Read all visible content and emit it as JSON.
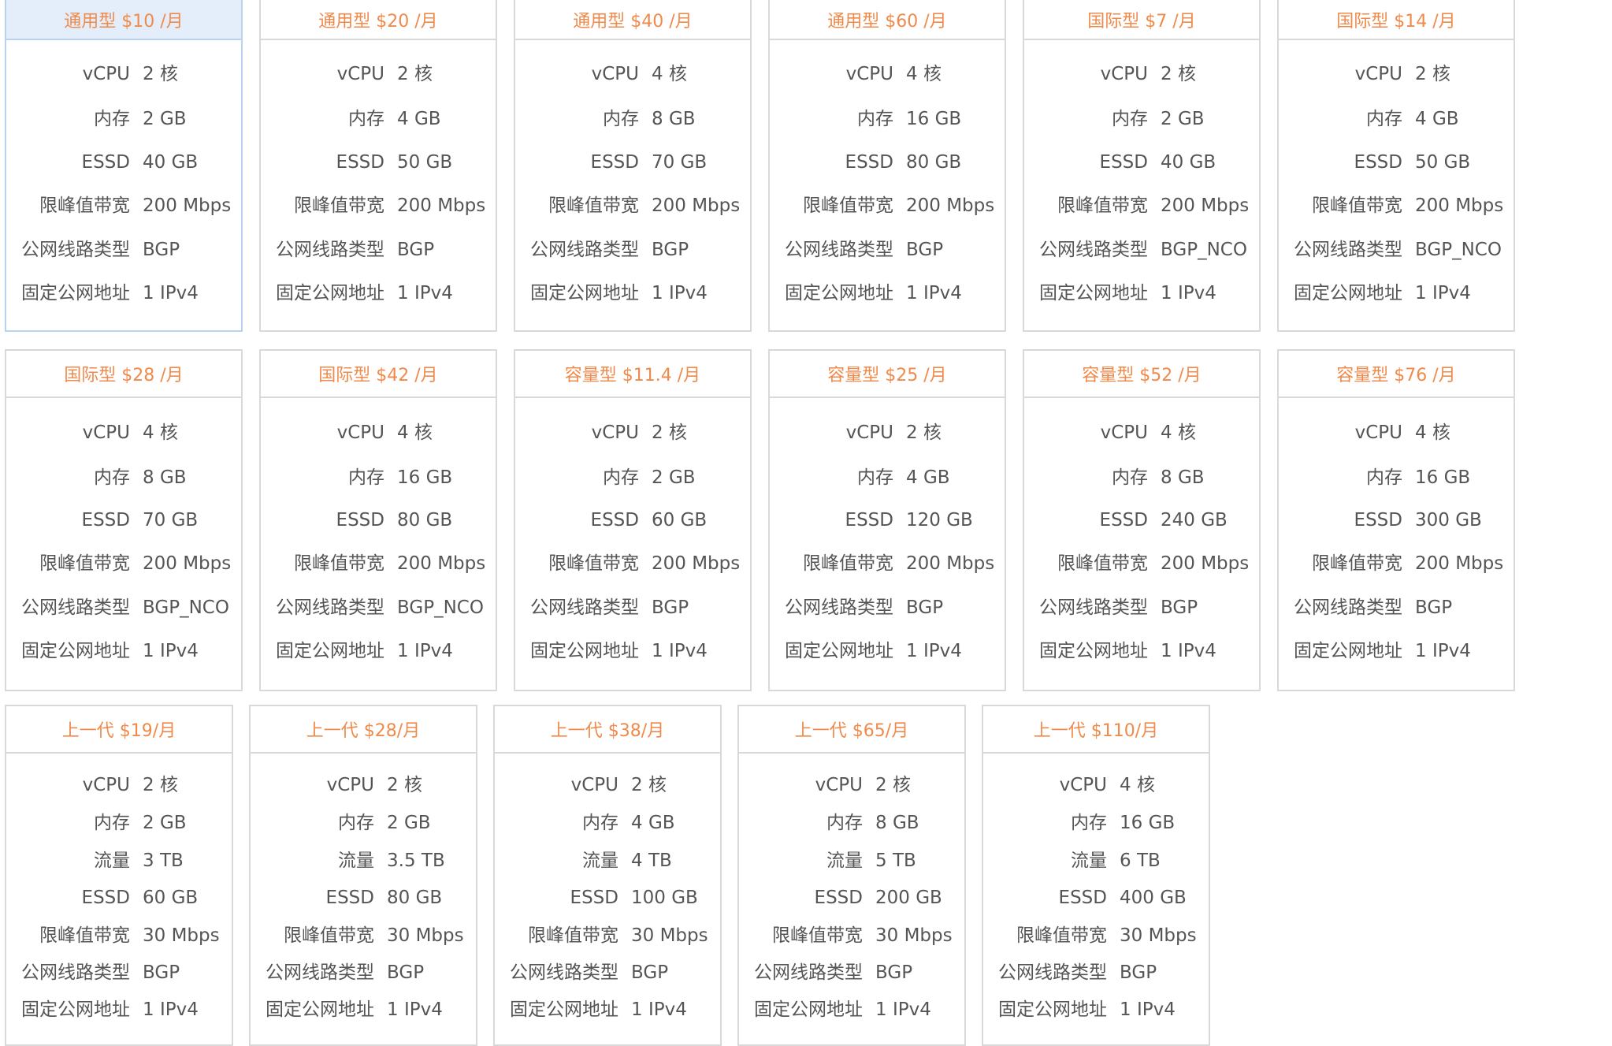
{
  "plans": [
    {
      "title": "通用型 $10 /月",
      "specs": [
        {
          "label": "vCPU",
          "value": "2 核"
        },
        {
          "label": "内存",
          "value": "2 GB"
        },
        {
          "label": "ESSD",
          "value": "40 GB"
        },
        {
          "label": "限峰值带宽",
          "value": "200 Mbps"
        },
        {
          "label": "公网线路类型",
          "value": "BGP"
        },
        {
          "label": "固定公网地址",
          "value": "1 IPv4"
        }
      ]
    },
    {
      "title": "通用型 $20 /月",
      "specs": [
        {
          "label": "vCPU",
          "value": "2 核"
        },
        {
          "label": "内存",
          "value": "4 GB"
        },
        {
          "label": "ESSD",
          "value": "50 GB"
        },
        {
          "label": "限峰值带宽",
          "value": "200 Mbps"
        },
        {
          "label": "公网线路类型",
          "value": "BGP"
        },
        {
          "label": "固定公网地址",
          "value": "1 IPv4"
        }
      ]
    },
    {
      "title": "通用型 $40 /月",
      "specs": [
        {
          "label": "vCPU",
          "value": "4 核"
        },
        {
          "label": "内存",
          "value": "8 GB"
        },
        {
          "label": "ESSD",
          "value": "70 GB"
        },
        {
          "label": "限峰值带宽",
          "value": "200 Mbps"
        },
        {
          "label": "公网线路类型",
          "value": "BGP"
        },
        {
          "label": "固定公网地址",
          "value": "1 IPv4"
        }
      ]
    },
    {
      "title": "通用型 $60 /月",
      "specs": [
        {
          "label": "vCPU",
          "value": "4 核"
        },
        {
          "label": "内存",
          "value": "16 GB"
        },
        {
          "label": "ESSD",
          "value": "80 GB"
        },
        {
          "label": "限峰值带宽",
          "value": "200 Mbps"
        },
        {
          "label": "公网线路类型",
          "value": "BGP"
        },
        {
          "label": "固定公网地址",
          "value": "1 IPv4"
        }
      ]
    },
    {
      "title": "国际型 $7 /月",
      "specs": [
        {
          "label": "vCPU",
          "value": "2 核"
        },
        {
          "label": "内存",
          "value": "2 GB"
        },
        {
          "label": "ESSD",
          "value": "40 GB"
        },
        {
          "label": "限峰值带宽",
          "value": "200 Mbps"
        },
        {
          "label": "公网线路类型",
          "value": "BGP_NCO"
        },
        {
          "label": "固定公网地址",
          "value": "1 IPv4"
        }
      ]
    },
    {
      "title": "国际型 $14 /月",
      "specs": [
        {
          "label": "vCPU",
          "value": "2 核"
        },
        {
          "label": "内存",
          "value": "4 GB"
        },
        {
          "label": "ESSD",
          "value": "50 GB"
        },
        {
          "label": "限峰值带宽",
          "value": "200 Mbps"
        },
        {
          "label": "公网线路类型",
          "value": "BGP_NCO"
        },
        {
          "label": "固定公网地址",
          "value": "1 IPv4"
        }
      ]
    },
    {
      "title": "国际型 $28 /月",
      "specs": [
        {
          "label": "vCPU",
          "value": "4 核"
        },
        {
          "label": "内存",
          "value": "8 GB"
        },
        {
          "label": "ESSD",
          "value": "70 GB"
        },
        {
          "label": "限峰值带宽",
          "value": "200 Mbps"
        },
        {
          "label": "公网线路类型",
          "value": "BGP_NCO"
        },
        {
          "label": "固定公网地址",
          "value": "1 IPv4"
        }
      ]
    },
    {
      "title": "国际型 $42 /月",
      "specs": [
        {
          "label": "vCPU",
          "value": "4 核"
        },
        {
          "label": "内存",
          "value": "16 GB"
        },
        {
          "label": "ESSD",
          "value": "80 GB"
        },
        {
          "label": "限峰值带宽",
          "value": "200 Mbps"
        },
        {
          "label": "公网线路类型",
          "value": "BGP_NCO"
        },
        {
          "label": "固定公网地址",
          "value": "1 IPv4"
        }
      ]
    },
    {
      "title": "容量型 $11.4 /月",
      "specs": [
        {
          "label": "vCPU",
          "value": "2 核"
        },
        {
          "label": "内存",
          "value": "2 GB"
        },
        {
          "label": "ESSD",
          "value": "60 GB"
        },
        {
          "label": "限峰值带宽",
          "value": "200 Mbps"
        },
        {
          "label": "公网线路类型",
          "value": "BGP"
        },
        {
          "label": "固定公网地址",
          "value": "1 IPv4"
        }
      ]
    },
    {
      "title": "容量型 $25 /月",
      "specs": [
        {
          "label": "vCPU",
          "value": "2 核"
        },
        {
          "label": "内存",
          "value": "4 GB"
        },
        {
          "label": "ESSD",
          "value": "120 GB"
        },
        {
          "label": "限峰值带宽",
          "value": "200 Mbps"
        },
        {
          "label": "公网线路类型",
          "value": "BGP"
        },
        {
          "label": "固定公网地址",
          "value": "1 IPv4"
        }
      ]
    },
    {
      "title": "容量型 $52 /月",
      "specs": [
        {
          "label": "vCPU",
          "value": "4 核"
        },
        {
          "label": "内存",
          "value": "8 GB"
        },
        {
          "label": "ESSD",
          "value": "240 GB"
        },
        {
          "label": "限峰值带宽",
          "value": "200 Mbps"
        },
        {
          "label": "公网线路类型",
          "value": "BGP"
        },
        {
          "label": "固定公网地址",
          "value": "1 IPv4"
        }
      ]
    },
    {
      "title": "容量型 $76 /月",
      "specs": [
        {
          "label": "vCPU",
          "value": "4 核"
        },
        {
          "label": "内存",
          "value": "16 GB"
        },
        {
          "label": "ESSD",
          "value": "300 GB"
        },
        {
          "label": "限峰值带宽",
          "value": "200 Mbps"
        },
        {
          "label": "公网线路类型",
          "value": "BGP"
        },
        {
          "label": "固定公网地址",
          "value": "1 IPv4"
        }
      ]
    },
    {
      "title": "上一代 $19/月",
      "specs": [
        {
          "label": "vCPU",
          "value": "2 核"
        },
        {
          "label": "内存",
          "value": "2 GB"
        },
        {
          "label": "流量",
          "value": "3 TB"
        },
        {
          "label": "ESSD",
          "value": "60 GB"
        },
        {
          "label": "限峰值带宽",
          "value": "30 Mbps"
        },
        {
          "label": "公网线路类型",
          "value": "BGP"
        },
        {
          "label": "固定公网地址",
          "value": "1 IPv4"
        }
      ]
    },
    {
      "title": "上一代 $28/月",
      "specs": [
        {
          "label": "vCPU",
          "value": "2 核"
        },
        {
          "label": "内存",
          "value": "2 GB"
        },
        {
          "label": "流量",
          "value": "3.5 TB"
        },
        {
          "label": "ESSD",
          "value": "80 GB"
        },
        {
          "label": "限峰值带宽",
          "value": "30 Mbps"
        },
        {
          "label": "公网线路类型",
          "value": "BGP"
        },
        {
          "label": "固定公网地址",
          "value": "1 IPv4"
        }
      ]
    },
    {
      "title": "上一代 $38/月",
      "specs": [
        {
          "label": "vCPU",
          "value": "2 核"
        },
        {
          "label": "内存",
          "value": "4 GB"
        },
        {
          "label": "流量",
          "value": "4 TB"
        },
        {
          "label": "ESSD",
          "value": "100 GB"
        },
        {
          "label": "限峰值带宽",
          "value": "30 Mbps"
        },
        {
          "label": "公网线路类型",
          "value": "BGP"
        },
        {
          "label": "固定公网地址",
          "value": "1 IPv4"
        }
      ]
    },
    {
      "title": "上一代 $65/月",
      "specs": [
        {
          "label": "vCPU",
          "value": "2 核"
        },
        {
          "label": "内存",
          "value": "8 GB"
        },
        {
          "label": "流量",
          "value": "5 TB"
        },
        {
          "label": "ESSD",
          "value": "200 GB"
        },
        {
          "label": "限峰值带宽",
          "value": "30 Mbps"
        },
        {
          "label": "公网线路类型",
          "value": "BGP"
        },
        {
          "label": "固定公网地址",
          "value": "1 IPv4"
        }
      ]
    },
    {
      "title": "上一代 $110/月",
      "specs": [
        {
          "label": "vCPU",
          "value": "4 核"
        },
        {
          "label": "内存",
          "value": "16 GB"
        },
        {
          "label": "流量",
          "value": "6 TB"
        },
        {
          "label": "ESSD",
          "value": "400 GB"
        },
        {
          "label": "限峰值带宽",
          "value": "30 Mbps"
        },
        {
          "label": "公网线路类型",
          "value": "BGP"
        },
        {
          "label": "固定公网地址",
          "value": "1 IPv4"
        }
      ]
    }
  ]
}
